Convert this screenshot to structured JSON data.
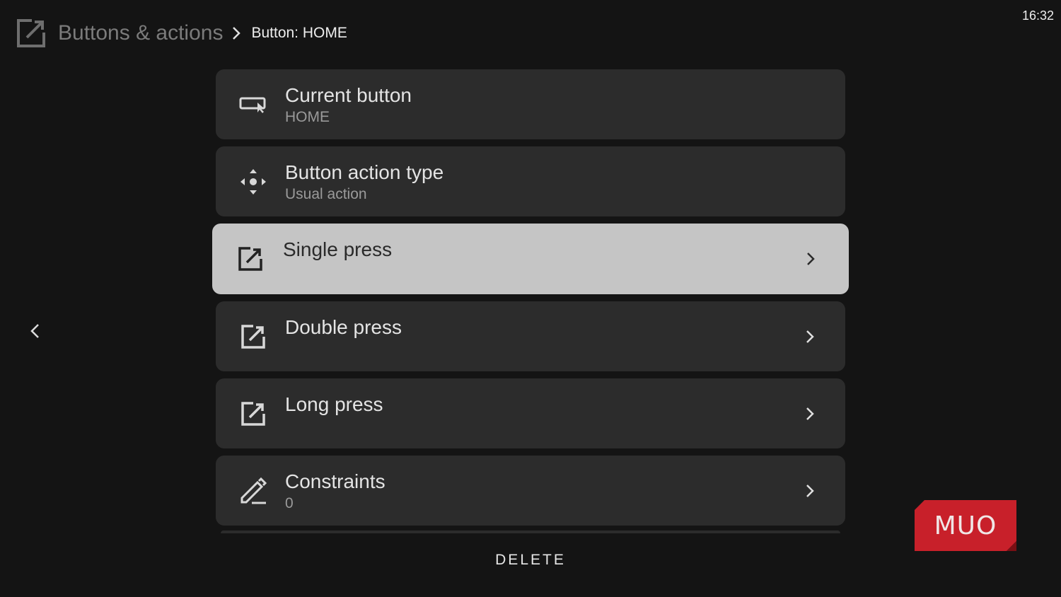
{
  "status": {
    "time": "16:32"
  },
  "header": {
    "app_icon": "open-in-new-icon",
    "parent": "Buttons & actions",
    "separator_icon": "chevron-right-icon",
    "current": "Button: HOME"
  },
  "nav": {
    "back_icon": "chevron-left-icon"
  },
  "items": [
    {
      "icon": "remote-button-icon",
      "title": "Current button",
      "subtitle": "HOME",
      "has_chevron": false
    },
    {
      "icon": "dpad-move-icon",
      "title": "Button action type",
      "subtitle": "Usual action",
      "has_chevron": false
    },
    {
      "icon": "open-in-new-icon",
      "title": "Single press",
      "subtitle": "",
      "has_chevron": true,
      "focused": true
    },
    {
      "icon": "open-in-new-icon",
      "title": "Double press",
      "subtitle": "",
      "has_chevron": true
    },
    {
      "icon": "open-in-new-icon",
      "title": "Long press",
      "subtitle": "",
      "has_chevron": true
    },
    {
      "icon": "pencil-line-icon",
      "title": "Constraints",
      "subtitle": "0",
      "has_chevron": true
    }
  ],
  "footer": {
    "delete_label": "DELETE"
  },
  "watermark": {
    "text": "MUO",
    "color": "#c8202a"
  },
  "colors": {
    "background": "#141414",
    "card": "#2c2c2c",
    "card_focused": "#c5c5c5",
    "breadcrumb_parent": "#7b7b7b",
    "subtitle": "#9a9a9a"
  }
}
